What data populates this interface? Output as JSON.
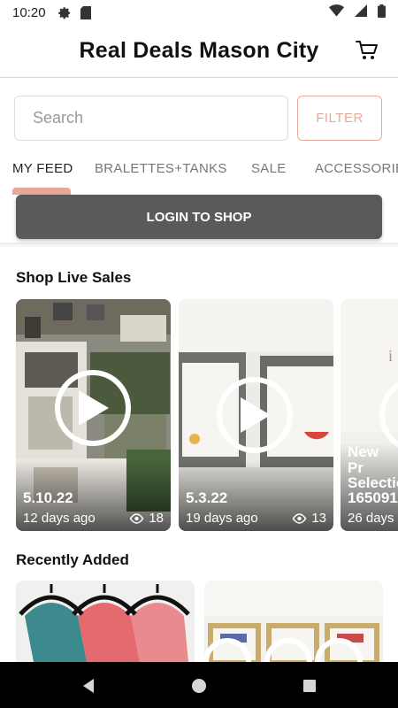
{
  "status_bar": {
    "time": "10:20",
    "icons": [
      "gear-icon",
      "sd-card-icon",
      "wifi-icon",
      "signal-icon",
      "battery-icon"
    ]
  },
  "header": {
    "title": "Real Deals Mason City",
    "cart_icon": "cart-icon"
  },
  "search": {
    "placeholder": "Search",
    "filter_label": "FILTER"
  },
  "tabs": [
    {
      "label": "MY FEED",
      "active": true
    },
    {
      "label": "BRALETTES+TANKS",
      "active": false
    },
    {
      "label": "SALE",
      "active": false
    },
    {
      "label": "ACCESSORIES",
      "active": false
    }
  ],
  "login_label": "LOGIN TO SHOP",
  "live_sales": {
    "title": "Shop Live Sales",
    "items": [
      {
        "date": "5.10.22",
        "ago": "12 days ago",
        "views": "18"
      },
      {
        "date": "5.3.22",
        "ago": "19 days ago",
        "views": "13"
      },
      {
        "title_line1": "New Pr",
        "title_line2": "Selectio",
        "title_line3": "165091",
        "ago": "26 days"
      }
    ]
  },
  "recently_added": {
    "title": "Recently Added"
  },
  "colors": {
    "accent": "#e9a897",
    "login_bg": "#5a5a5a",
    "header_border": "#e7cfc4"
  }
}
